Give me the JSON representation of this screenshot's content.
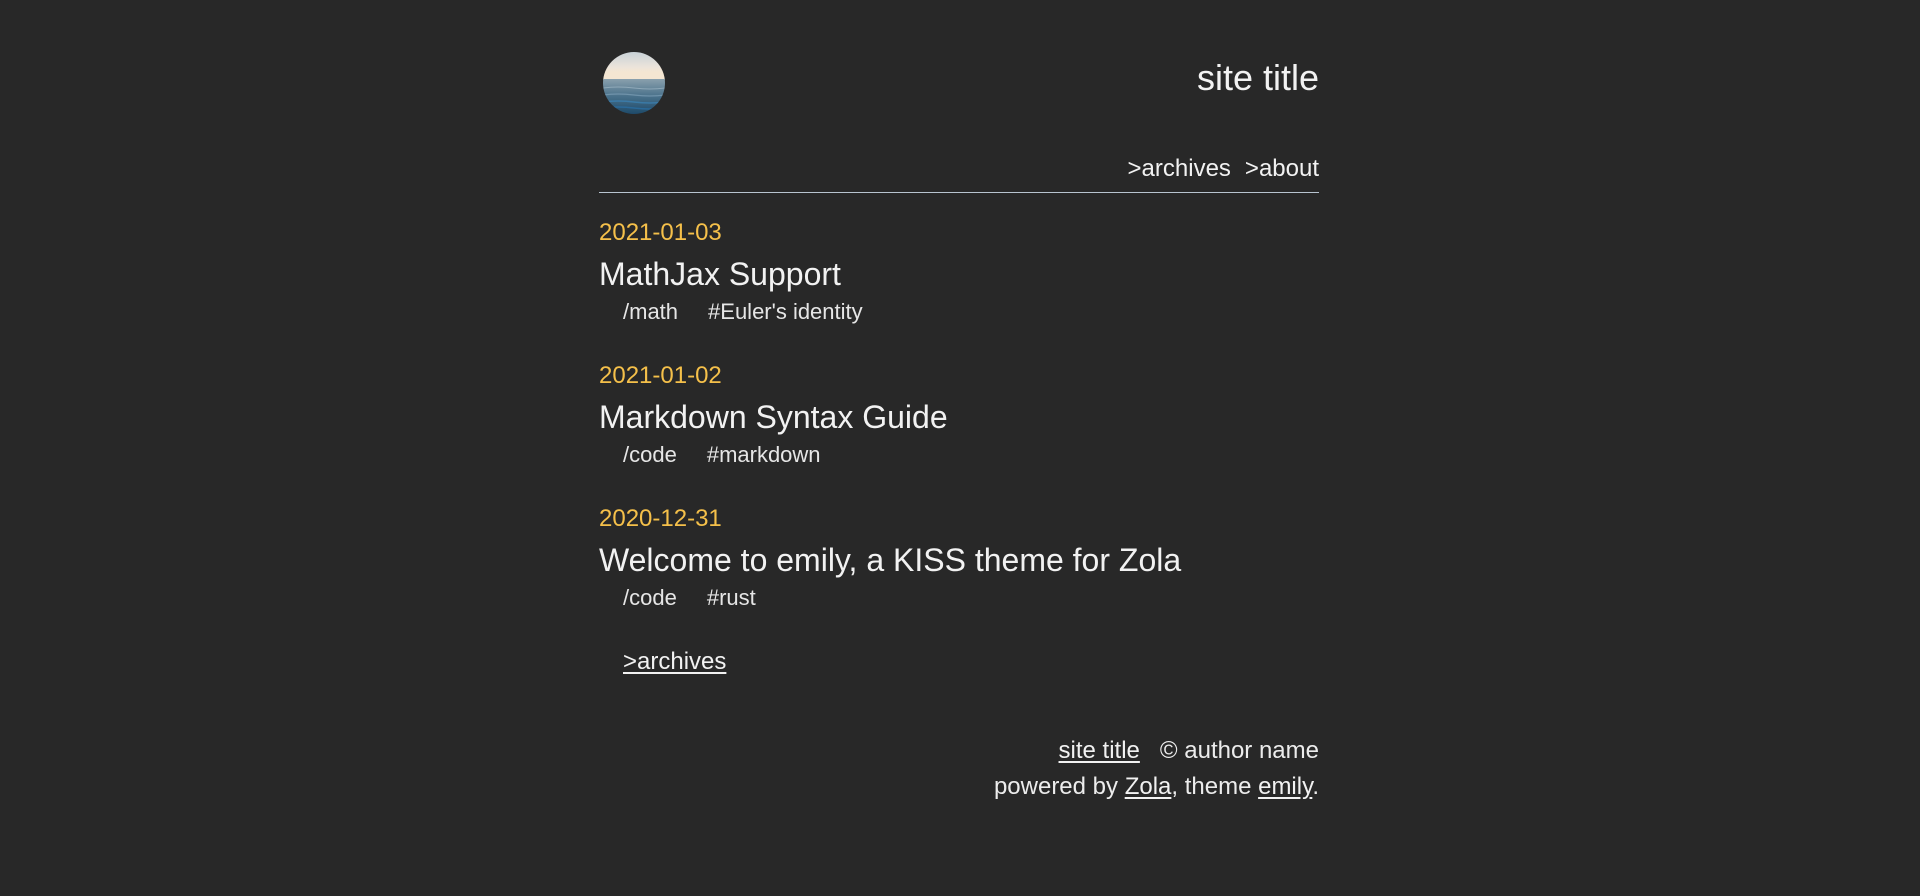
{
  "header": {
    "site_title": "site title",
    "avatar_icon": "ocean-horizon-avatar",
    "nav": [
      {
        "label": ">archives"
      },
      {
        "label": ">about"
      }
    ]
  },
  "posts": [
    {
      "date": "2021-01-03",
      "title": "MathJax Support",
      "category": "/math",
      "tag": "#Euler's identity"
    },
    {
      "date": "2021-01-02",
      "title": "Markdown Syntax Guide",
      "category": "/code",
      "tag": "#markdown"
    },
    {
      "date": "2020-12-31",
      "title": "Welcome to emily, a KISS theme for Zola",
      "category": "/code",
      "tag": "#rust"
    }
  ],
  "more_link": ">archives",
  "footer": {
    "site_link": "site title",
    "copyright": "© author name",
    "powered_prefix": "powered by ",
    "zola_link": "Zola",
    "theme_text": ", theme ",
    "emily_link": "emily",
    "end": "."
  },
  "colors": {
    "background": "#282828",
    "text": "#ececec",
    "date_accent": "#f5c04a",
    "rule": "#b8c4d0"
  }
}
